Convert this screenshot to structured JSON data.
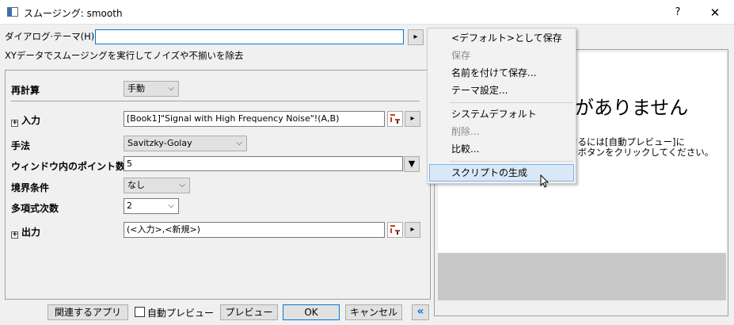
{
  "window": {
    "title": "スムージング: smooth",
    "help": "?",
    "close": "✕"
  },
  "theme": {
    "label": "ダイアログ·テーマ(H)",
    "value": "",
    "arrow": "▸"
  },
  "description": "XYデータでスムージングを実行してノイズや不揃いを除去",
  "form": {
    "recalc": {
      "label": "再計算",
      "value": "手動"
    },
    "input": {
      "label": "入力",
      "expander": "+",
      "value": "[Book1]\"Signal with High Frequency Noise\"!(A,B)"
    },
    "method": {
      "label": "手法",
      "value": "Savitzky-Golay"
    },
    "points": {
      "label": "ウィンドウ内のポイント数",
      "value": "5"
    },
    "boundary": {
      "label": "境界条件",
      "value": "なし"
    },
    "poly": {
      "label": "多項式次数",
      "value": "2"
    },
    "output": {
      "label": "出力",
      "expander": "+",
      "value": "(<入力>,<新規>)"
    }
  },
  "buttons": {
    "related_apps": "関連するアプリ",
    "auto_preview": "自動プレビュー",
    "preview": "プレビュー",
    "ok": "OK",
    "cancel": "キャンセル",
    "collapse": "«"
  },
  "preview": {
    "heading": "がありません",
    "line1": "するには[自動プレビュー]に",
    "line2": "ーボタンをクリックしてください。"
  },
  "menu": {
    "items": [
      {
        "label": "<デフォルト>として保存",
        "disabled": false
      },
      {
        "label": "保存",
        "disabled": true
      },
      {
        "label": "名前を付けて保存...",
        "disabled": false
      },
      {
        "label": "テーマ設定...",
        "disabled": false
      },
      {
        "label": "システムデフォルト",
        "disabled": false
      },
      {
        "label": "削除...",
        "disabled": true
      },
      {
        "label": "比較...",
        "disabled": false
      },
      {
        "label": "スクリプトの生成",
        "disabled": false
      }
    ]
  },
  "colors": {
    "accent": "#0078d7",
    "menu_hover": "#d9e8f7"
  }
}
